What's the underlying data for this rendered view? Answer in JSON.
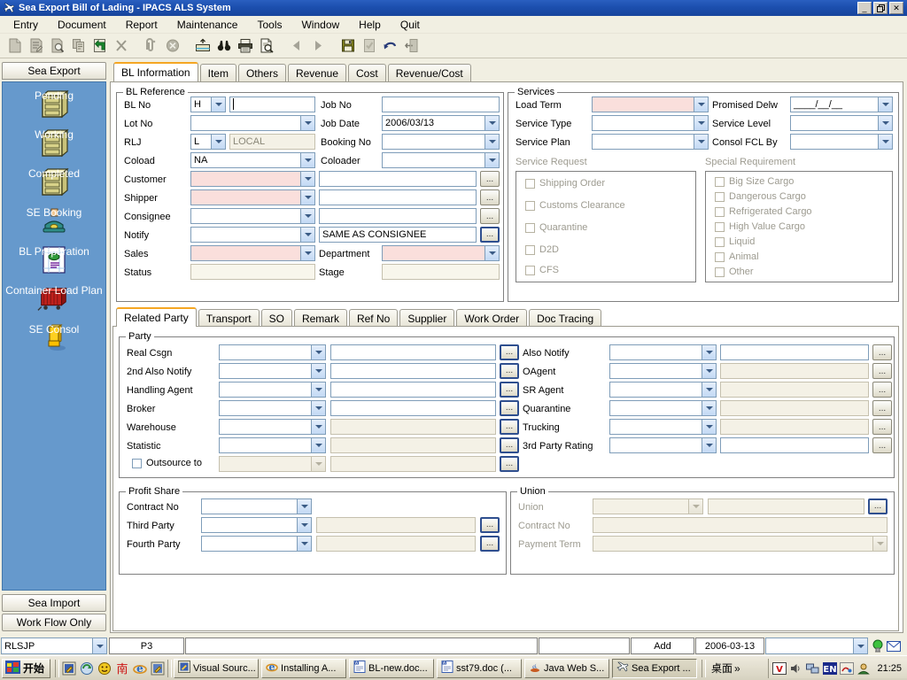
{
  "window": {
    "title": "Sea Export Bill of Lading - IPACS ALS System",
    "icon": "airplane-icon",
    "buttons": {
      "minimize": "_",
      "restore": "❐",
      "close": "✕"
    }
  },
  "menubar": {
    "items": [
      "Entry",
      "Document",
      "Report",
      "Maintenance",
      "Tools",
      "Window",
      "Help",
      "Quit"
    ]
  },
  "toolbar": {
    "items": [
      {
        "name": "new-icon",
        "enabled": false
      },
      {
        "name": "edit-icon",
        "enabled": false
      },
      {
        "name": "view-icon",
        "enabled": false
      },
      {
        "name": "copy-icon",
        "enabled": false
      },
      {
        "name": "paste-return-icon",
        "enabled": true
      },
      {
        "name": "delete-x-icon",
        "enabled": false
      },
      {
        "name": "separator",
        "enabled": false
      },
      {
        "name": "attach-icon",
        "enabled": false
      },
      {
        "name": "cancel-circle-icon",
        "enabled": false
      },
      {
        "name": "separator",
        "enabled": false
      },
      {
        "name": "archive-icon",
        "enabled": true
      },
      {
        "name": "find-binoculars-icon",
        "enabled": true
      },
      {
        "name": "print-icon",
        "enabled": true
      },
      {
        "name": "print-preview-icon",
        "enabled": true
      },
      {
        "name": "separator",
        "enabled": false
      },
      {
        "name": "prev-arrow-icon",
        "enabled": false
      },
      {
        "name": "next-arrow-icon",
        "enabled": false
      },
      {
        "name": "separator",
        "enabled": false
      },
      {
        "name": "save-disk-icon",
        "enabled": true
      },
      {
        "name": "confirm-icon",
        "enabled": false
      },
      {
        "name": "undo-icon",
        "enabled": true
      },
      {
        "name": "exit-door-icon",
        "enabled": false
      }
    ]
  },
  "sidebar": {
    "header": "Sea Export",
    "items": [
      {
        "label": "Pending",
        "icon": "cabinet-icon"
      },
      {
        "label": "Working",
        "icon": "cabinet-icon"
      },
      {
        "label": "Completed",
        "icon": "cabinet-icon"
      },
      {
        "label": "SE Booking",
        "icon": "telephone-icon"
      },
      {
        "label": "BL Preparation",
        "icon": "document-money-icon"
      },
      {
        "label": "Container Load Plan",
        "icon": "container-icon"
      },
      {
        "label": "SE Consol",
        "icon": "gold-bar-icon"
      }
    ],
    "footer": [
      "Sea Import",
      "Work Flow Only"
    ]
  },
  "main_tabs": {
    "items": [
      "BL Information",
      "Item",
      "Others",
      "Revenue",
      "Cost",
      "Revenue/Cost"
    ],
    "active": "BL Information"
  },
  "bl_reference": {
    "legend": "BL Reference",
    "rows": [
      {
        "label": "BL No",
        "prefix": "H",
        "value": "",
        "right_label": "Job No",
        "right_value": ""
      },
      {
        "label": "Lot No",
        "prefix": null,
        "value": "",
        "right_label": "Job Date",
        "right_value": "2006/03/13"
      },
      {
        "label": "RLJ",
        "prefix": "L",
        "value": "LOCAL",
        "right_label": "Booking No",
        "right_value": ""
      },
      {
        "label": "Coload",
        "prefix": null,
        "value": "NA",
        "right_label": "Coloader",
        "right_value": ""
      },
      {
        "label": "Customer",
        "prefix": null,
        "value": "",
        "right_label": "",
        "right_value": ""
      },
      {
        "label": "Shipper",
        "prefix": null,
        "value": "",
        "right_label": "",
        "right_value": ""
      },
      {
        "label": "Consignee",
        "prefix": null,
        "value": "",
        "right_label": "",
        "right_value": ""
      },
      {
        "label": "Notify",
        "prefix": null,
        "value": "",
        "right_label": "",
        "right_value": "SAME AS CONSIGNEE"
      },
      {
        "label": "Sales",
        "prefix": null,
        "value": "",
        "right_label": "Department",
        "right_value": ""
      },
      {
        "label": "Status",
        "prefix": null,
        "value": "",
        "right_label": "Stage",
        "right_value": ""
      }
    ]
  },
  "services": {
    "legend": "Services",
    "left": [
      {
        "label": "Load Term",
        "value": "",
        "required": true
      },
      {
        "label": "Service Type",
        "value": "",
        "required": false
      },
      {
        "label": "Service Plan",
        "value": "",
        "required": false
      }
    ],
    "right": [
      {
        "label": "Promised Delw",
        "value": "____/__/__"
      },
      {
        "label": "Service Level",
        "value": ""
      },
      {
        "label": "Consol FCL By",
        "value": ""
      }
    ],
    "service_request": {
      "label": "Service Request",
      "options": [
        "Shipping Order",
        "Customs Clearance",
        "Quarantine",
        "D2D",
        "CFS"
      ]
    },
    "special_requirement": {
      "label": "Special Requirement",
      "options": [
        "Big Size Cargo",
        "Dangerous Cargo",
        "Refrigerated Cargo",
        "High Value Cargo",
        "Liquid",
        "Animal",
        "Other"
      ]
    }
  },
  "sub_tabs": {
    "items": [
      "Related Party",
      "Transport",
      "SO",
      "Remark",
      "Ref No",
      "Supplier",
      "Work Order",
      "Doc Tracing"
    ],
    "active": "Related Party"
  },
  "party": {
    "legend": "Party",
    "left_rows": [
      {
        "label": "Real Csgn",
        "code": "",
        "name": "",
        "readonly": false
      },
      {
        "label": "2nd Also Notify",
        "code": "",
        "name": "",
        "readonly": false
      },
      {
        "label": "Handling Agent",
        "code": "",
        "name": "",
        "readonly": false
      },
      {
        "label": "Broker",
        "code": "",
        "name": "",
        "readonly": false
      },
      {
        "label": "Warehouse",
        "code": "",
        "name": "",
        "readonly": true
      },
      {
        "label": "Statistic",
        "code": "",
        "name": "",
        "readonly": true
      }
    ],
    "outsource": {
      "label": "Outsource to",
      "code": "",
      "name": "",
      "checked": false
    },
    "right_rows": [
      {
        "label": "Also Notify",
        "code": "",
        "name": "",
        "readonly": false
      },
      {
        "label": "OAgent",
        "code": "",
        "name": "",
        "readonly": true
      },
      {
        "label": "SR Agent",
        "code": "",
        "name": "",
        "readonly": true
      },
      {
        "label": "Quarantine",
        "code": "",
        "name": "",
        "readonly": true
      },
      {
        "label": "Trucking",
        "code": "",
        "name": "",
        "readonly": true
      },
      {
        "label": "3rd Party Rating",
        "code": "",
        "name": "",
        "readonly": false
      }
    ],
    "dots_label": "..."
  },
  "profit_share": {
    "legend": "Profit Share",
    "rows": [
      {
        "label": "Contract No",
        "code": "",
        "name": null
      },
      {
        "label": "Third Party",
        "code": "",
        "name": ""
      },
      {
        "label": "Fourth Party",
        "code": "",
        "name": ""
      }
    ]
  },
  "union": {
    "legend": "Union",
    "rows": [
      {
        "label": "Union",
        "code": "",
        "name": ""
      },
      {
        "label": "Contract No",
        "code": "",
        "name": null
      },
      {
        "label": "Payment Term",
        "code": "",
        "name": null
      }
    ]
  },
  "statusbar": {
    "user_combo": "RLSJP",
    "terminal": "P3",
    "message": "",
    "field4": "",
    "mode": "Add",
    "date": "2006-03-13",
    "extra_combo": "",
    "icons": [
      "lightbulb-icon",
      "mail-icon"
    ]
  },
  "taskbar": {
    "start": "开始",
    "quicklaunch": [
      "edit-icon",
      "refresh-icon",
      "smiley-icon",
      "ime-south-icon",
      "ie-icon",
      "app-icon"
    ],
    "windows": [
      {
        "label": "Visual Sourc...",
        "icon": "vss-icon",
        "active": false
      },
      {
        "label": "Installing A...",
        "icon": "ie-icon",
        "active": false
      },
      {
        "label": "BL-new.doc...",
        "icon": "word-icon",
        "active": false
      },
      {
        "label": "sst79.doc (...",
        "icon": "word-icon",
        "active": false
      },
      {
        "label": "Java Web S...",
        "icon": "java-icon",
        "active": false
      },
      {
        "label": "Sea Export ...",
        "icon": "airplane-icon",
        "active": true
      }
    ],
    "desktop_group": {
      "label": "桌面",
      "chevron": "»"
    },
    "tray": [
      "vc-icon",
      "volume-icon",
      "network-icon",
      "lang-EN-icon",
      "ime-icon",
      "user-icon"
    ],
    "clock": "21:25"
  }
}
